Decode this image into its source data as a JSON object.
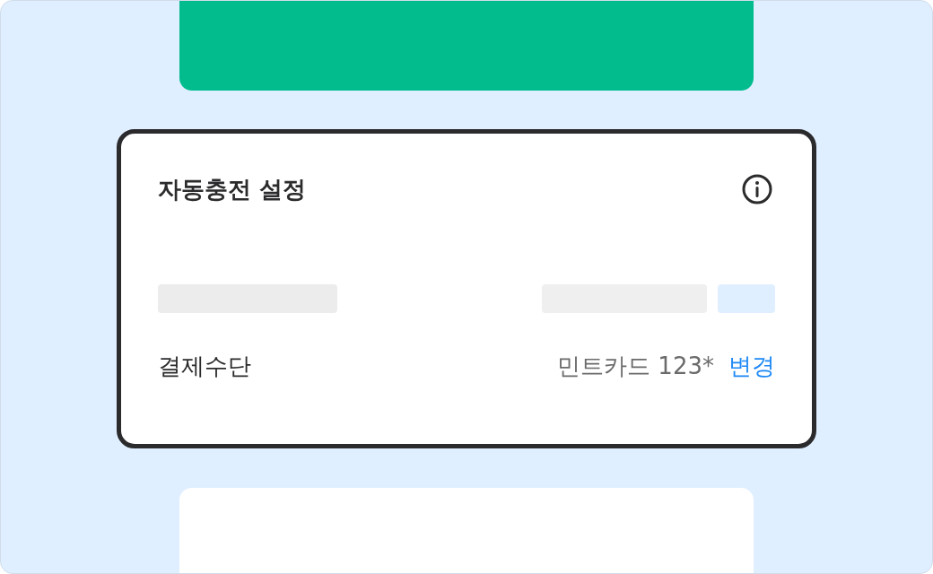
{
  "card": {
    "title": "자동충전 설정",
    "payment": {
      "label": "결제수단",
      "value": "민트카드 123*",
      "action": "변경"
    }
  }
}
